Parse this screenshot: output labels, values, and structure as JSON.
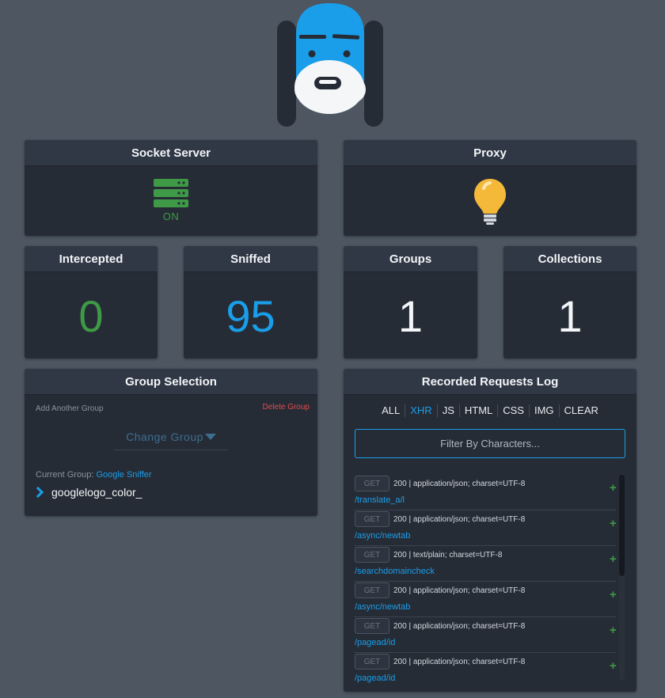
{
  "colors": {
    "accent": "#1a9ee9",
    "on": "#3e9a46",
    "danger": "#e24b4b"
  },
  "socket_server": {
    "title": "Socket Server",
    "status": "ON",
    "icon": "server-icon"
  },
  "proxy": {
    "title": "Proxy",
    "icon": "lightbulb-icon"
  },
  "stats": {
    "intercepted": {
      "title": "Intercepted",
      "value": "0"
    },
    "sniffed": {
      "title": "Sniffed",
      "value": "95"
    },
    "groups": {
      "title": "Groups",
      "value": "1"
    },
    "collections": {
      "title": "Collections",
      "value": "1"
    }
  },
  "group_selection": {
    "title": "Group Selection",
    "add_label": "Add Another Group",
    "delete_label": "Delete Group",
    "select_label": "Change Group",
    "current_label": "Current Group:",
    "current_value": "Google Sniffer",
    "items": [
      "googlelogo_color_"
    ]
  },
  "log": {
    "title": "Recorded Requests Log",
    "filters": [
      "ALL",
      "XHR",
      "JS",
      "HTML",
      "CSS",
      "IMG",
      "CLEAR"
    ],
    "active_filter": "XHR",
    "search_placeholder": "Filter By Characters...",
    "requests": [
      {
        "method": "GET",
        "status": "200 | application/json; charset=UTF-8",
        "path": "/translate_a/l"
      },
      {
        "method": "GET",
        "status": "200 | application/json; charset=UTF-8",
        "path": "/async/newtab"
      },
      {
        "method": "GET",
        "status": "200 | text/plain; charset=UTF-8",
        "path": "/searchdomaincheck"
      },
      {
        "method": "GET",
        "status": "200 | application/json; charset=UTF-8",
        "path": "/async/newtab"
      },
      {
        "method": "GET",
        "status": "200 | application/json; charset=UTF-8",
        "path": "/pagead/id"
      },
      {
        "method": "GET",
        "status": "200 | application/json; charset=UTF-8",
        "path": "/pagead/id"
      }
    ]
  }
}
